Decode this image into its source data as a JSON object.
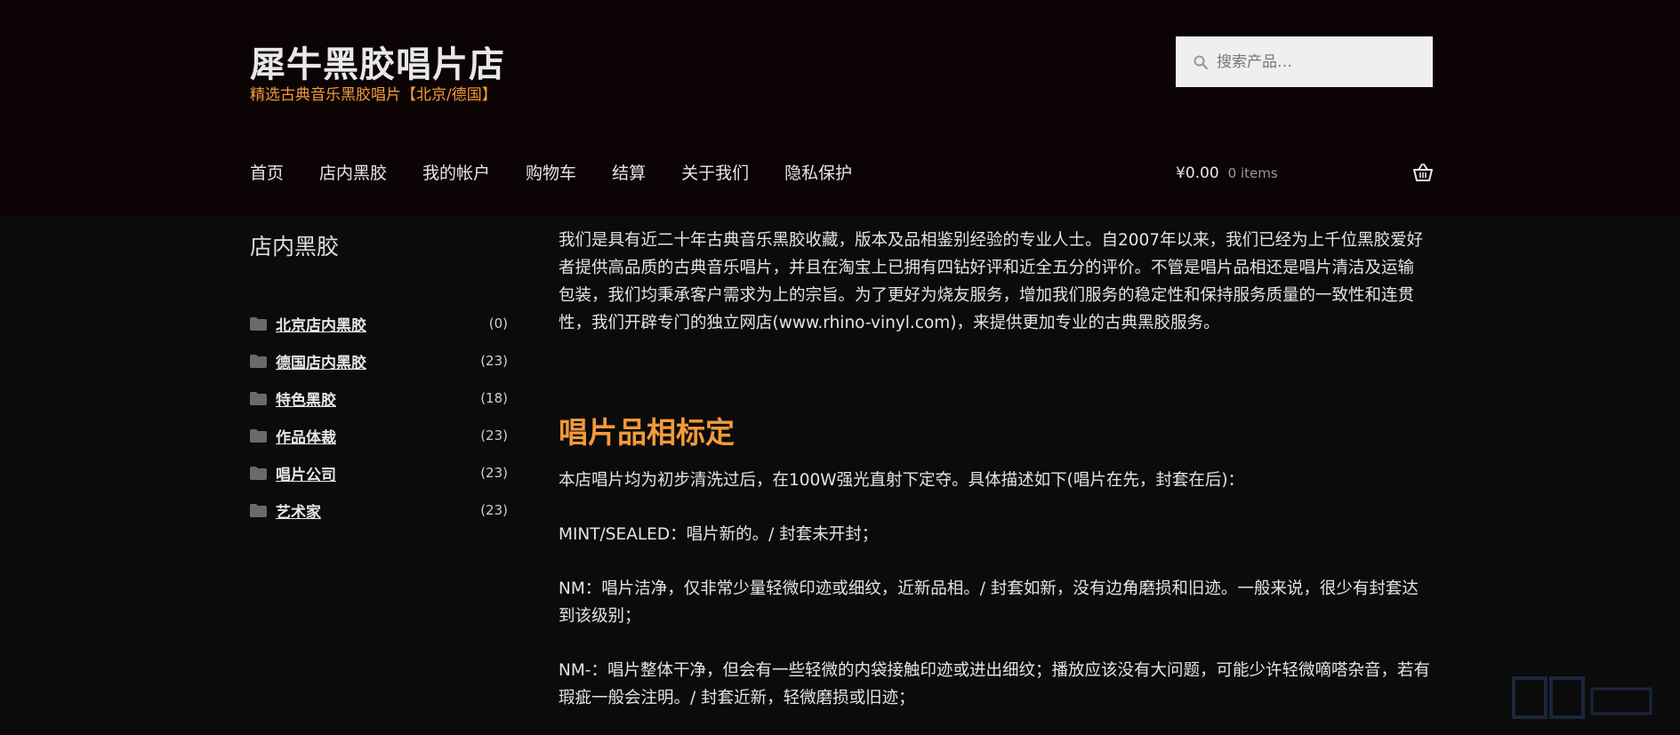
{
  "header": {
    "title": "犀牛黑胶唱片店",
    "tagline": "精选古典音乐黑胶唱片【北京/德国】",
    "search_placeholder": "搜索产品…"
  },
  "nav": {
    "items": [
      "首页",
      "店内黑胶",
      "我的帐户",
      "购物车",
      "结算",
      "关于我们",
      "隐私保护"
    ]
  },
  "cart": {
    "amount": "¥0.00",
    "count": "0 items"
  },
  "sidebar": {
    "title": "店内黑胶",
    "categories": [
      {
        "name": "北京店内黑胶",
        "count": "(0)"
      },
      {
        "name": "德国店内黑胶",
        "count": "(23)"
      },
      {
        "name": "特色黑胶",
        "count": "(18)"
      },
      {
        "name": "作品体裁",
        "count": "(23)"
      },
      {
        "name": "唱片公司",
        "count": "(23)"
      },
      {
        "name": "艺术家",
        "count": "(23)"
      }
    ]
  },
  "content": {
    "intro": "我们是具有近二十年古典音乐黑胶收藏，版本及品相鉴别经验的专业人士。自2007年以来，我们已经为上千位黑胶爱好者提供高品质的古典音乐唱片，并且在淘宝上已拥有四钻好评和近全五分的评价。不管是唱片品相还是唱片清洁及运输包装，我们均秉承客户需求为上的宗旨。为了更好为烧友服务，增加我们服务的稳定性和保持服务质量的一致性和连贯性，我们开辟专门的独立网店(www.rhino-vinyl.com)，来提供更加专业的古典黑胶服务。",
    "heading": "唱片品相标定",
    "p1": "本店唱片均为初步清洗过后，在100W强光直射下定夺。具体描述如下(唱片在先，封套在后)：",
    "p2": "MINT/SEALED：唱片新的。/ 封套未开封；",
    "p3": "NM：唱片洁净，仅非常少量轻微印迹或细纹，近新品相。/ 封套如新，没有边角磨损和旧迹。一般来说，很少有封套达到该级别；",
    "p4": "NM-：唱片整体干净，但会有一些轻微的内袋接触印迹或进出细纹；播放应该没有大问题，可能少许轻微嘀嗒杂音，若有瑕疵一般会注明。/ 封套近新，轻微磨损或旧迹；"
  }
}
